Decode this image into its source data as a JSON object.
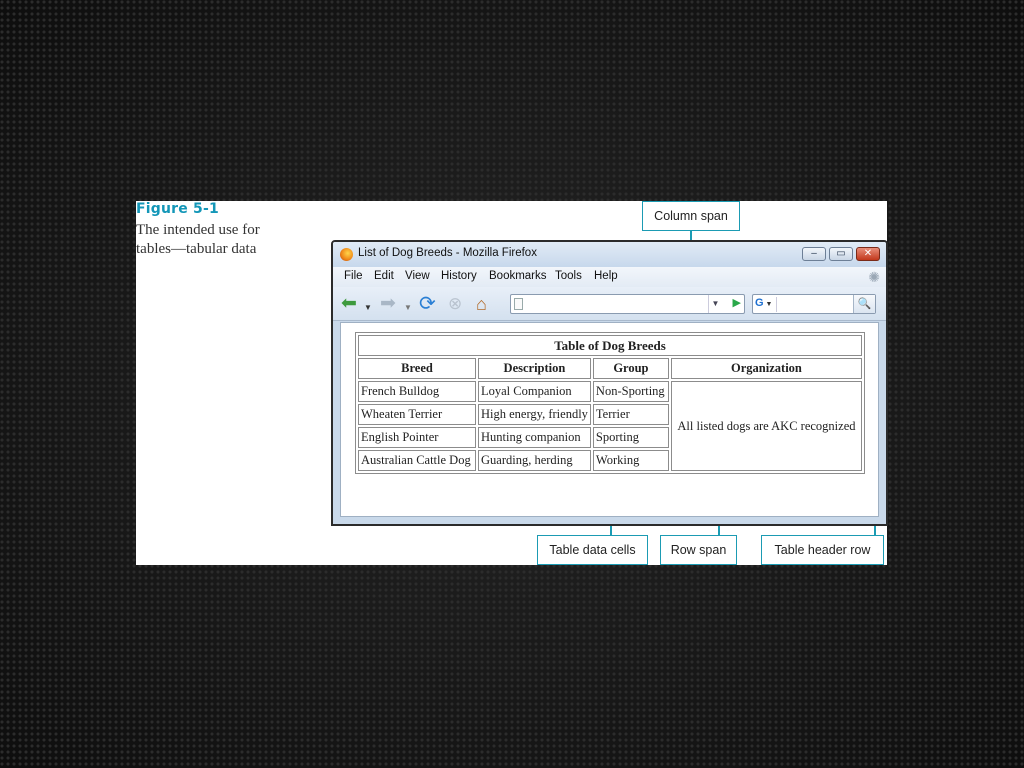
{
  "figure": {
    "label": "Figure 5-1",
    "caption": "The intended use for tables—tabular data"
  },
  "browser": {
    "window_title": "List of Dog Breeds - Mozilla Firefox",
    "menu": [
      "File",
      "Edit",
      "View",
      "History",
      "Bookmarks",
      "Tools",
      "Help"
    ],
    "url_value": "",
    "search_value": "",
    "search_engine": "G"
  },
  "table": {
    "title": "Table of Dog Breeds",
    "headers": [
      "Breed",
      "Description",
      "Group",
      "Organization"
    ],
    "rows": [
      [
        "French Bulldog",
        "Loyal Companion",
        "Non-Sporting"
      ],
      [
        "Wheaten Terrier",
        "High energy, friendly",
        "Terrier"
      ],
      [
        "English Pointer",
        "Hunting companion",
        "Sporting"
      ],
      [
        "Australian Cattle Dog",
        "Guarding, herding",
        "Working"
      ]
    ],
    "rowspan_cell": "All listed dogs are AKC recognized"
  },
  "callouts": {
    "column_span": "Column span",
    "table_data_cells": "Table data cells",
    "row_span": "Row span",
    "table_header_row": "Table header row"
  },
  "colors": {
    "accent": "#1b9bb3",
    "figure_label": "#1497b8"
  }
}
